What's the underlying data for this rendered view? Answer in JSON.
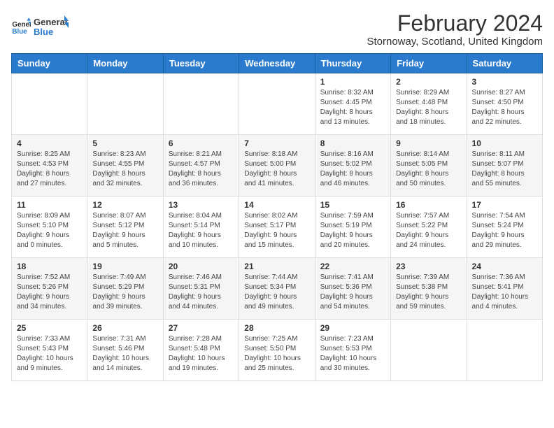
{
  "logo": {
    "line1": "General",
    "line2": "Blue"
  },
  "title": "February 2024",
  "subtitle": "Stornoway, Scotland, United Kingdom",
  "days_of_week": [
    "Sunday",
    "Monday",
    "Tuesday",
    "Wednesday",
    "Thursday",
    "Friday",
    "Saturday"
  ],
  "weeks": [
    [
      {
        "day": "",
        "info": ""
      },
      {
        "day": "",
        "info": ""
      },
      {
        "day": "",
        "info": ""
      },
      {
        "day": "",
        "info": ""
      },
      {
        "day": "1",
        "info": "Sunrise: 8:32 AM\nSunset: 4:45 PM\nDaylight: 8 hours\nand 13 minutes."
      },
      {
        "day": "2",
        "info": "Sunrise: 8:29 AM\nSunset: 4:48 PM\nDaylight: 8 hours\nand 18 minutes."
      },
      {
        "day": "3",
        "info": "Sunrise: 8:27 AM\nSunset: 4:50 PM\nDaylight: 8 hours\nand 22 minutes."
      }
    ],
    [
      {
        "day": "4",
        "info": "Sunrise: 8:25 AM\nSunset: 4:53 PM\nDaylight: 8 hours\nand 27 minutes."
      },
      {
        "day": "5",
        "info": "Sunrise: 8:23 AM\nSunset: 4:55 PM\nDaylight: 8 hours\nand 32 minutes."
      },
      {
        "day": "6",
        "info": "Sunrise: 8:21 AM\nSunset: 4:57 PM\nDaylight: 8 hours\nand 36 minutes."
      },
      {
        "day": "7",
        "info": "Sunrise: 8:18 AM\nSunset: 5:00 PM\nDaylight: 8 hours\nand 41 minutes."
      },
      {
        "day": "8",
        "info": "Sunrise: 8:16 AM\nSunset: 5:02 PM\nDaylight: 8 hours\nand 46 minutes."
      },
      {
        "day": "9",
        "info": "Sunrise: 8:14 AM\nSunset: 5:05 PM\nDaylight: 8 hours\nand 50 minutes."
      },
      {
        "day": "10",
        "info": "Sunrise: 8:11 AM\nSunset: 5:07 PM\nDaylight: 8 hours\nand 55 minutes."
      }
    ],
    [
      {
        "day": "11",
        "info": "Sunrise: 8:09 AM\nSunset: 5:10 PM\nDaylight: 9 hours\nand 0 minutes."
      },
      {
        "day": "12",
        "info": "Sunrise: 8:07 AM\nSunset: 5:12 PM\nDaylight: 9 hours\nand 5 minutes."
      },
      {
        "day": "13",
        "info": "Sunrise: 8:04 AM\nSunset: 5:14 PM\nDaylight: 9 hours\nand 10 minutes."
      },
      {
        "day": "14",
        "info": "Sunrise: 8:02 AM\nSunset: 5:17 PM\nDaylight: 9 hours\nand 15 minutes."
      },
      {
        "day": "15",
        "info": "Sunrise: 7:59 AM\nSunset: 5:19 PM\nDaylight: 9 hours\nand 20 minutes."
      },
      {
        "day": "16",
        "info": "Sunrise: 7:57 AM\nSunset: 5:22 PM\nDaylight: 9 hours\nand 24 minutes."
      },
      {
        "day": "17",
        "info": "Sunrise: 7:54 AM\nSunset: 5:24 PM\nDaylight: 9 hours\nand 29 minutes."
      }
    ],
    [
      {
        "day": "18",
        "info": "Sunrise: 7:52 AM\nSunset: 5:26 PM\nDaylight: 9 hours\nand 34 minutes."
      },
      {
        "day": "19",
        "info": "Sunrise: 7:49 AM\nSunset: 5:29 PM\nDaylight: 9 hours\nand 39 minutes."
      },
      {
        "day": "20",
        "info": "Sunrise: 7:46 AM\nSunset: 5:31 PM\nDaylight: 9 hours\nand 44 minutes."
      },
      {
        "day": "21",
        "info": "Sunrise: 7:44 AM\nSunset: 5:34 PM\nDaylight: 9 hours\nand 49 minutes."
      },
      {
        "day": "22",
        "info": "Sunrise: 7:41 AM\nSunset: 5:36 PM\nDaylight: 9 hours\nand 54 minutes."
      },
      {
        "day": "23",
        "info": "Sunrise: 7:39 AM\nSunset: 5:38 PM\nDaylight: 9 hours\nand 59 minutes."
      },
      {
        "day": "24",
        "info": "Sunrise: 7:36 AM\nSunset: 5:41 PM\nDaylight: 10 hours\nand 4 minutes."
      }
    ],
    [
      {
        "day": "25",
        "info": "Sunrise: 7:33 AM\nSunset: 5:43 PM\nDaylight: 10 hours\nand 9 minutes."
      },
      {
        "day": "26",
        "info": "Sunrise: 7:31 AM\nSunset: 5:46 PM\nDaylight: 10 hours\nand 14 minutes."
      },
      {
        "day": "27",
        "info": "Sunrise: 7:28 AM\nSunset: 5:48 PM\nDaylight: 10 hours\nand 19 minutes."
      },
      {
        "day": "28",
        "info": "Sunrise: 7:25 AM\nSunset: 5:50 PM\nDaylight: 10 hours\nand 25 minutes."
      },
      {
        "day": "29",
        "info": "Sunrise: 7:23 AM\nSunset: 5:53 PM\nDaylight: 10 hours\nand 30 minutes."
      },
      {
        "day": "",
        "info": ""
      },
      {
        "day": "",
        "info": ""
      }
    ]
  ]
}
